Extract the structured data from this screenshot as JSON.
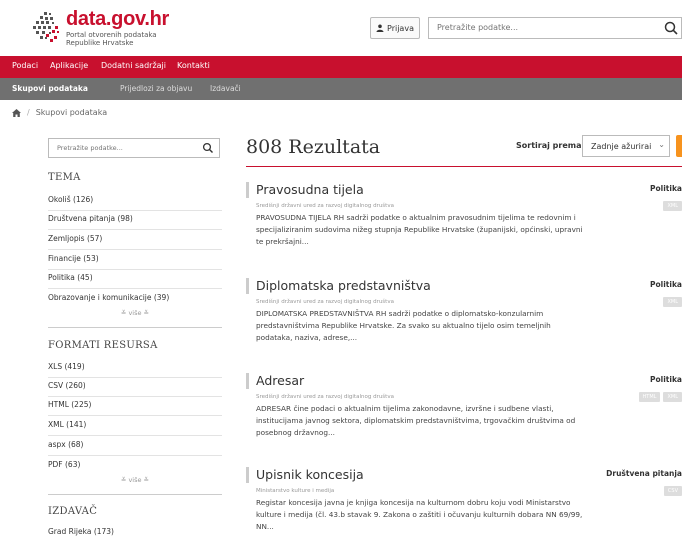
{
  "brand": {
    "title": "data.gov.hr",
    "subtitle_line1": "Portal otvorenih podataka",
    "subtitle_line2": "Republike Hrvatske"
  },
  "header": {
    "login_label": "Prijava",
    "search_placeholder": "Pretražite podatke..."
  },
  "nav": {
    "items": [
      "Podaci",
      "Aplikacije",
      "Dodatni sadržaji",
      "Kontakti"
    ]
  },
  "subnav": {
    "items": [
      "Skupovi podataka",
      "Prijedlozi za objavu",
      "Izdavači"
    ]
  },
  "breadcrumb": {
    "current": "Skupovi podataka"
  },
  "sidebar": {
    "search_placeholder": "Pretražite podatke...",
    "tema_heading": "TEMA",
    "tema_items": [
      "Okoliš (126)",
      "Društvena pitanja (98)",
      "Zemljopis (57)",
      "Financije (53)",
      "Politika (45)",
      "Obrazovanje i komunikacije (39)"
    ],
    "more_label": "≚ više ≚",
    "formati_heading": "FORMATI RESURSA",
    "formati_items": [
      "XLS (419)",
      "CSV (260)",
      "HTML (225)",
      "XML (141)",
      "aspx (68)",
      "PDF (63)"
    ],
    "izdavac_heading": "IZDAVAČ",
    "izdavac_items": [
      "Grad Rijeka (173)"
    ]
  },
  "results": {
    "title": "808 Rezultata",
    "sort_label": "Sortiraj prema:",
    "sort_value": "Zadnje ažurirai",
    "items": [
      {
        "title": "Pravosudna tijela",
        "org": "Središnji državni ured za razvoj digitalnog društva",
        "desc": "PRAVOSUDNA TIJELA RH sadrži podatke o aktualnim pravosudnim tijelima te redovnim i specijaliziranim sudovima nižeg stupnja Republike Hrvatske (županijski, općinski, upravni te prekršajni...",
        "category": "Politika",
        "formats": [
          "XML"
        ]
      },
      {
        "title": "Diplomatska predstavništva",
        "org": "Središnji državni ured za razvoj digitalnog društva",
        "desc": "DIPLOMATSKA PREDSTAVNIŠTVA RH sadrži podatke o diplomatsko-konzularnim predstavništvima Republike Hrvatske. Za svako su aktualno tijelo osim temeljnih podataka, naziva, adrese,...",
        "category": "Politika",
        "formats": [
          "XML"
        ]
      },
      {
        "title": "Adresar",
        "org": "Središnji državni ured za razvoj digitalnog društva",
        "desc": "ADRESAR čine podaci o aktualnim tijelima zakonodavne, izvršne i sudbene vlasti, institucijama javnog sektora, diplomatskim predstavništvima, trgovačkim društvima od posebnog državnog...",
        "category": "Politika",
        "formats": [
          "HTML",
          "XML"
        ]
      },
      {
        "title": "Upisnik koncesija",
        "org": "Ministarstvo kulture i medija",
        "desc": "Registar koncesija javna je knjiga koncesija na kulturnom dobru koju vodi Ministarstvo kulture i medija (čl. 43.b stavak 9. Zakona o zaštiti i očuvanju kulturnih dobara NN 69/99, NN...",
        "category": "Društvena pitanja",
        "formats": [
          "CSV"
        ]
      }
    ]
  },
  "colors": {
    "brand_red": "#c8102e",
    "subnav_grey": "#707070",
    "rss_orange": "#f7931e"
  }
}
